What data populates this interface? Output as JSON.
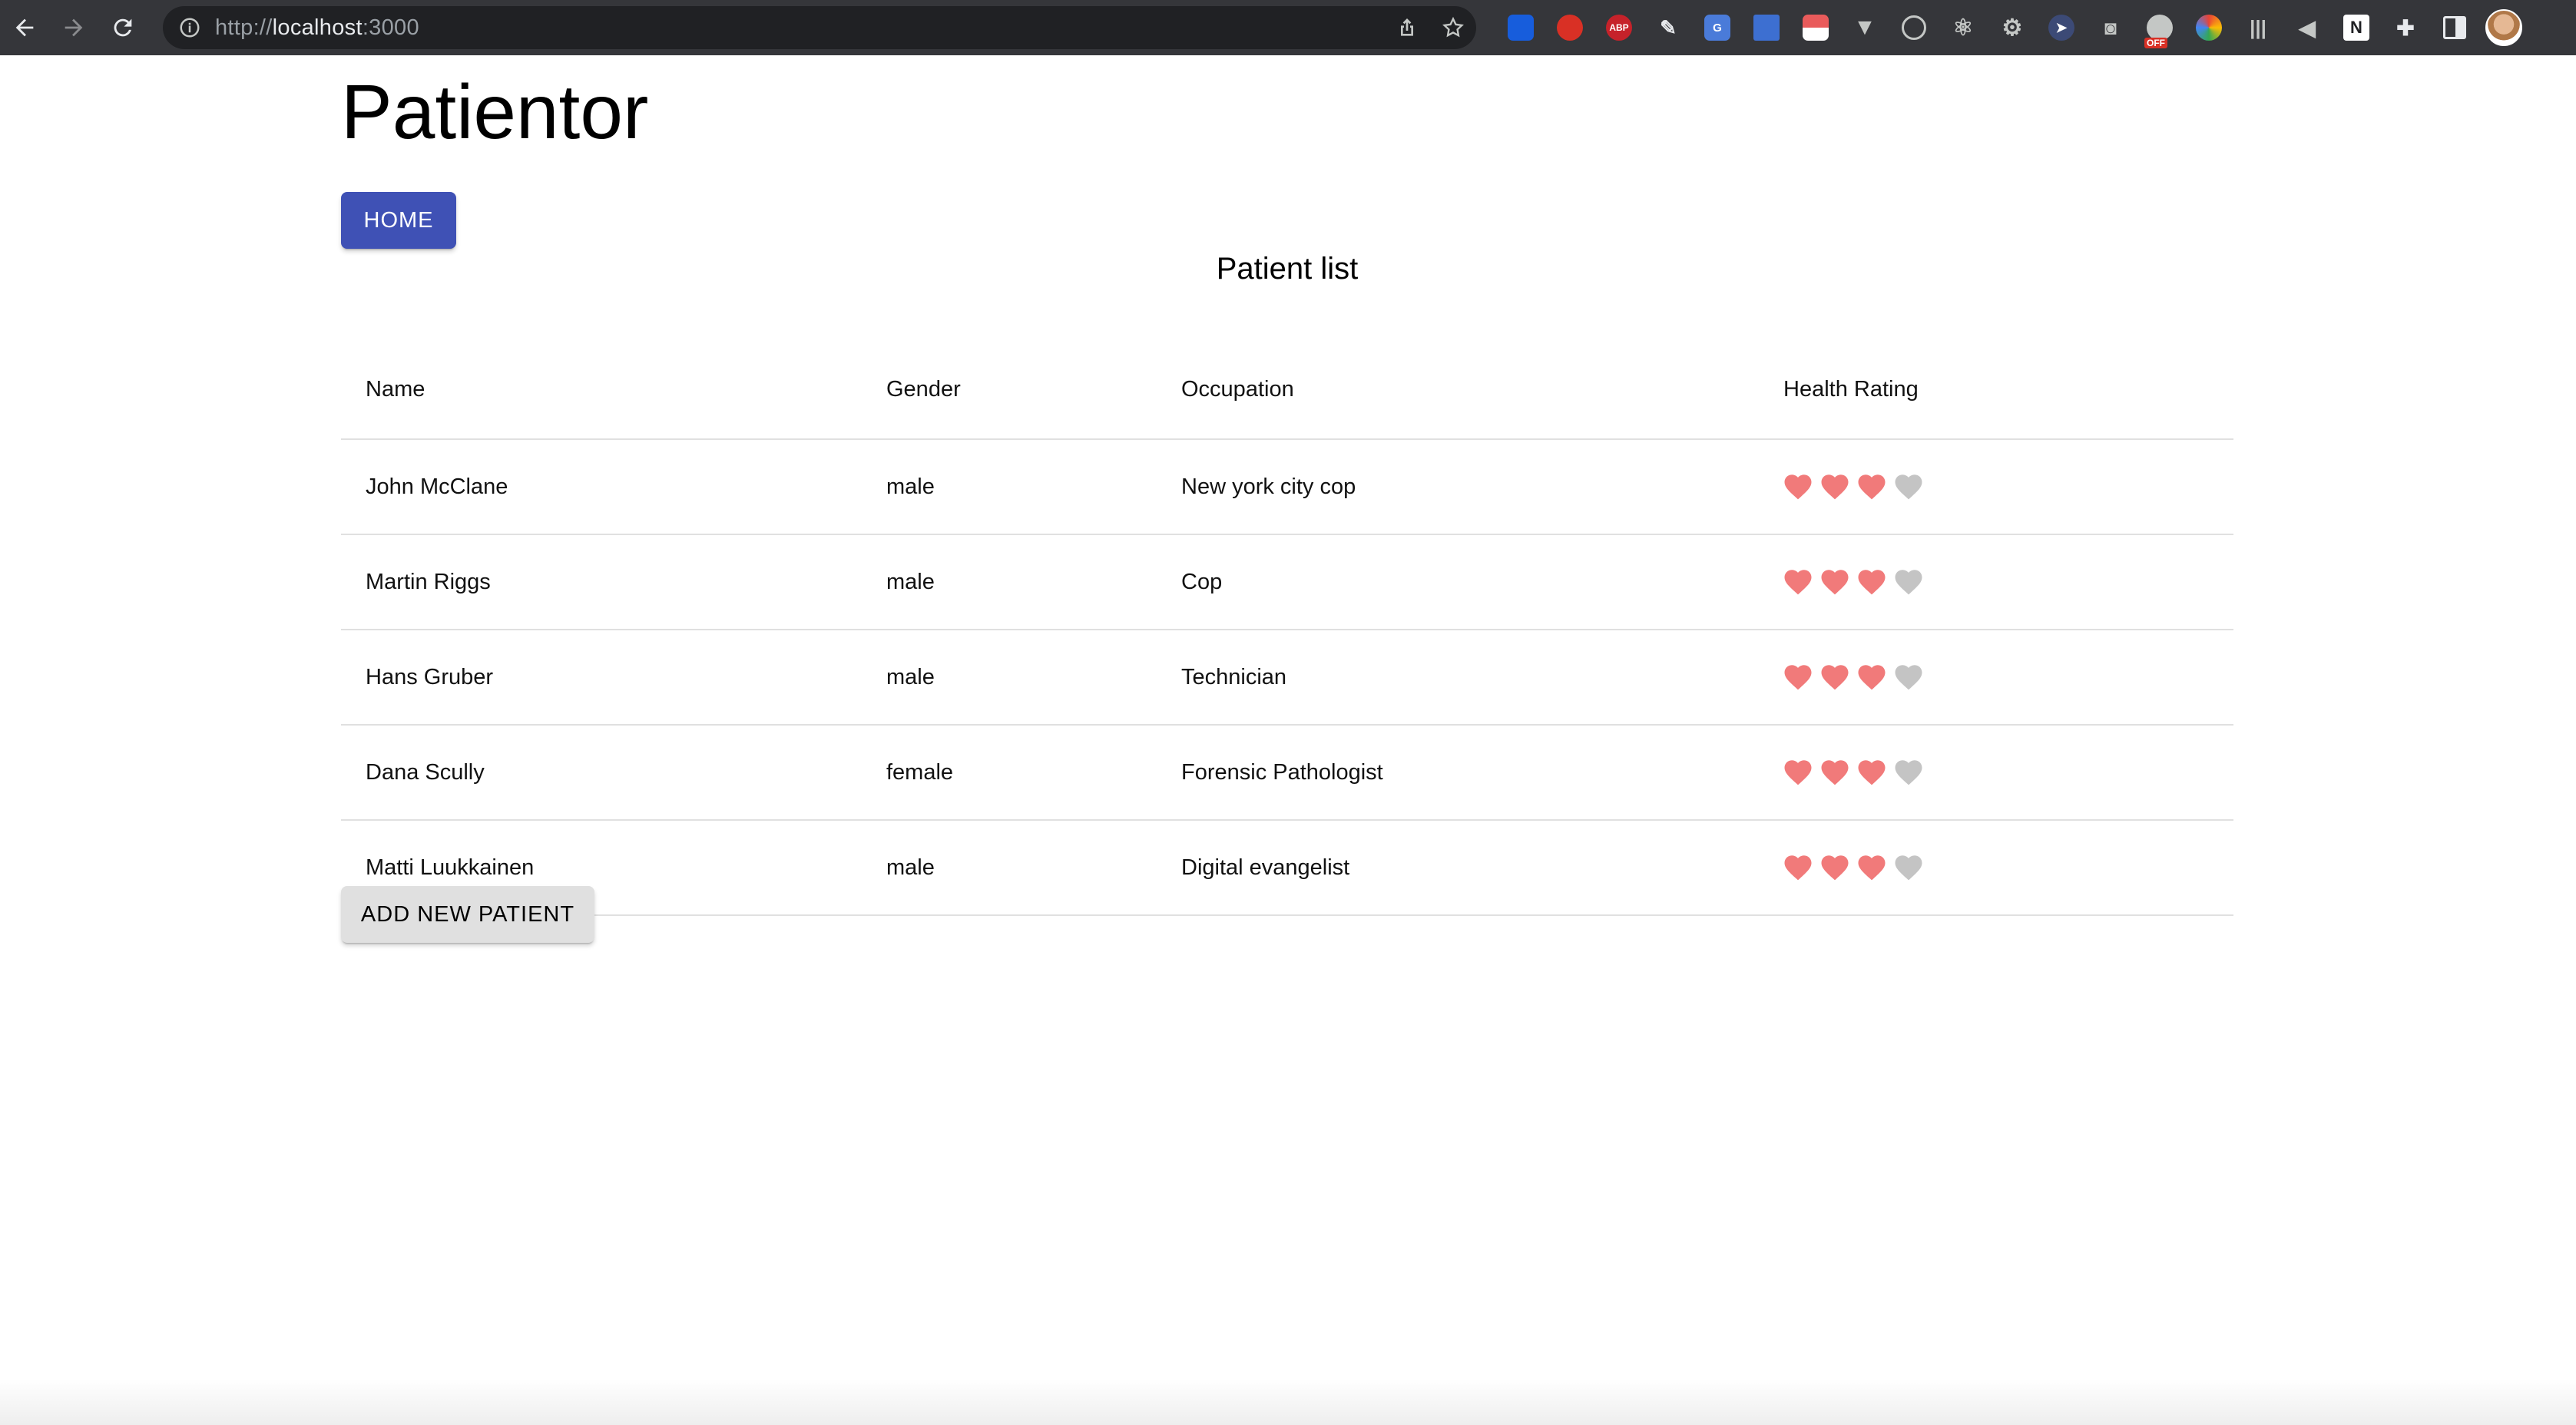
{
  "browser": {
    "url_scheme": "http://",
    "url_host": "localhost",
    "url_port": ":3000"
  },
  "app": {
    "title": "Patientor",
    "home_button": "HOME"
  },
  "patient_list": {
    "title": "Patient list",
    "columns": [
      "Name",
      "Gender",
      "Occupation",
      "Health Rating"
    ],
    "max_rating": 4,
    "rows": [
      {
        "name": "John McClane",
        "gender": "male",
        "occupation": "New york city cop",
        "health_rating": 3
      },
      {
        "name": "Martin Riggs",
        "gender": "male",
        "occupation": "Cop",
        "health_rating": 3
      },
      {
        "name": "Hans Gruber",
        "gender": "male",
        "occupation": "Technician",
        "health_rating": 3
      },
      {
        "name": "Dana Scully",
        "gender": "female",
        "occupation": "Forensic Pathologist",
        "health_rating": 3
      },
      {
        "name": "Matti Luukkainen",
        "gender": "male",
        "occupation": "Digital evangelist",
        "health_rating": 3
      }
    ],
    "add_button": "ADD NEW PATIENT"
  },
  "colors": {
    "primary": "#3f51b5",
    "heart_filled": "#f17a7a",
    "heart_empty": "#c4c4c4",
    "browser_toolbar": "#35363a"
  },
  "extension_icons": {
    "badge_label": "OFF"
  }
}
